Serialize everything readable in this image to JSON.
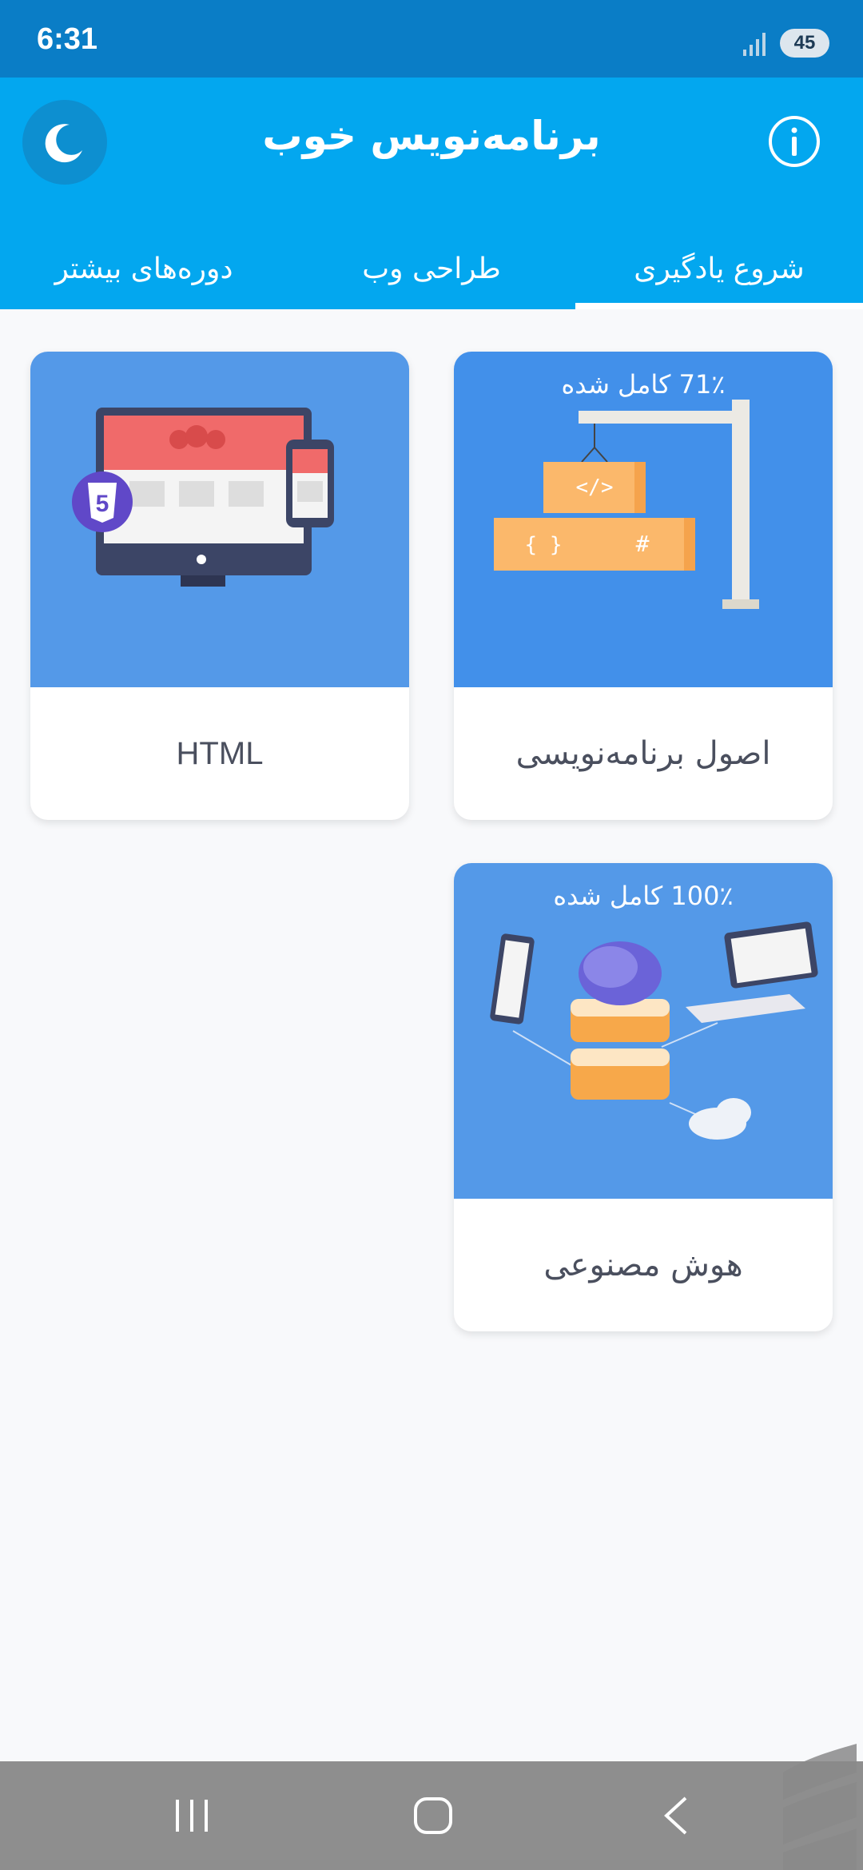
{
  "status_bar": {
    "time": "6:31",
    "battery": "45",
    "signal_icon": "signal-icon"
  },
  "app_bar": {
    "title": "برنامه‌نویس خوب",
    "theme_icon": "moon-icon",
    "info_icon": "info-icon",
    "tabs": [
      {
        "label": "شروع یادگیری",
        "active": true
      },
      {
        "label": "طراحی وب",
        "active": false
      },
      {
        "label": "دوره‌های بیشتر",
        "active": false
      }
    ]
  },
  "cards": [
    {
      "label": "اصول برنامه‌نویسی",
      "progress": "71٪ کامل شده",
      "icon": "crane-code-blocks-illustration"
    },
    {
      "label": "HTML",
      "progress": "",
      "icon": "html5-devices-illustration"
    },
    {
      "label": "هوش مصنوعی",
      "progress": "100٪ کامل شده",
      "icon": "ai-brain-network-illustration"
    }
  ],
  "nav_bar": {
    "recents_icon": "recents-icon",
    "home_icon": "home-icon",
    "back_icon": "back-icon"
  },
  "colors": {
    "status_bar": "#0a7dc6",
    "app_bar": "#03a7ef",
    "card_blue_1": "#4290ea",
    "card_blue_2": "#5499e8",
    "background": "#f8f9fb"
  }
}
